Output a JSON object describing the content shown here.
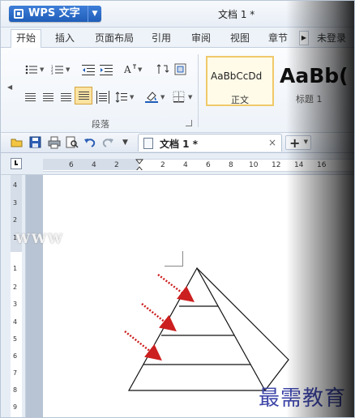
{
  "app": {
    "menu_label": "WPS 文字",
    "document_title": "文档 1 *"
  },
  "tabs": [
    "开始",
    "插入",
    "页面布局",
    "引用",
    "审阅",
    "视图",
    "章节",
    "未登录"
  ],
  "ribbon": {
    "paragraph_group_label": "段落",
    "styles": [
      {
        "sample": "AaBbCcDd",
        "label": "正文"
      },
      {
        "sample": "AaBb(",
        "label": "标题 1"
      }
    ]
  },
  "doc_tab": {
    "name": "文档 1 *",
    "close": "×",
    "new_tab": "+"
  },
  "ruler": {
    "ticks": [
      "6",
      "4",
      "2",
      "2",
      "4",
      "6",
      "8",
      "10",
      "12",
      "14",
      "16"
    ]
  },
  "vertical_ruler": {
    "ticks": [
      "4",
      "3",
      "2",
      "1",
      "1",
      "2",
      "3",
      "4",
      "5",
      "6",
      "7",
      "8",
      "9"
    ]
  },
  "watermarks": {
    "top": "WWW",
    "bottom": "最需教育"
  },
  "colors": {
    "accent": "#1f5db9",
    "arrow": "#cc1f1f",
    "watermark": "#3d45a8"
  }
}
